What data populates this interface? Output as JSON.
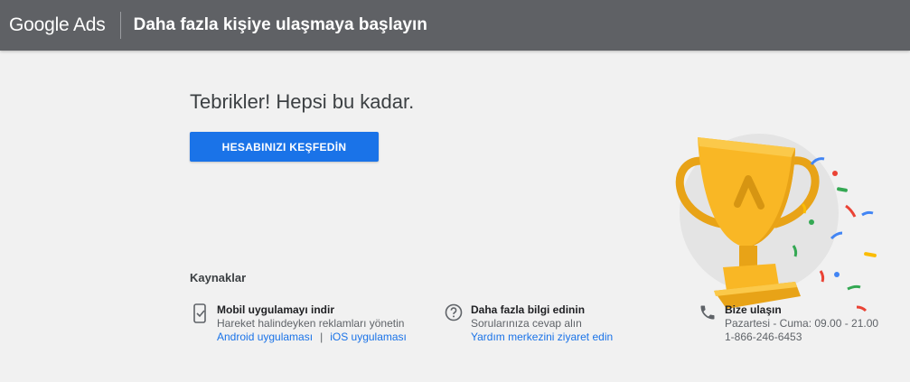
{
  "header": {
    "brand": "Google Ads",
    "title": "Daha fazla kişiye ulaşmaya başlayın"
  },
  "main": {
    "congrats": "Tebrikler! Hepsi bu kadar.",
    "cta_label": "HESABINIZI KEŞFEDİN"
  },
  "resources": {
    "title": "Kaynaklar",
    "mobile": {
      "icon": "phone-app-icon",
      "title": "Mobil uygulamayı indir",
      "subtitle": "Hareket halindeyken reklamları yönetin",
      "android_link": "Android uygulaması",
      "separator": "|",
      "ios_link": "iOS uygulaması"
    },
    "learn": {
      "icon": "help-circle-icon",
      "title": "Daha fazla bilgi edinin",
      "subtitle": "Sorularınıza cevap alın",
      "link": "Yardım merkezini ziyaret edin"
    },
    "contact": {
      "icon": "phone-icon",
      "title": "Bize ulaşın",
      "hours": "Pazartesi - Cuma: 09.00 - 21.00",
      "phone": "1-866-246-6453"
    }
  },
  "illustration": {
    "icon": "trophy-icon",
    "colors": {
      "gold": "#f9b725",
      "gold_dark": "#e8a317",
      "confetti_blue": "#4285f4",
      "confetti_red": "#ea4335",
      "confetti_green": "#34a853",
      "confetti_yellow": "#fbbc04"
    }
  },
  "colors": {
    "header_bg": "#5f6165",
    "page_bg": "#f1f1f1",
    "accent": "#1a73e8"
  }
}
